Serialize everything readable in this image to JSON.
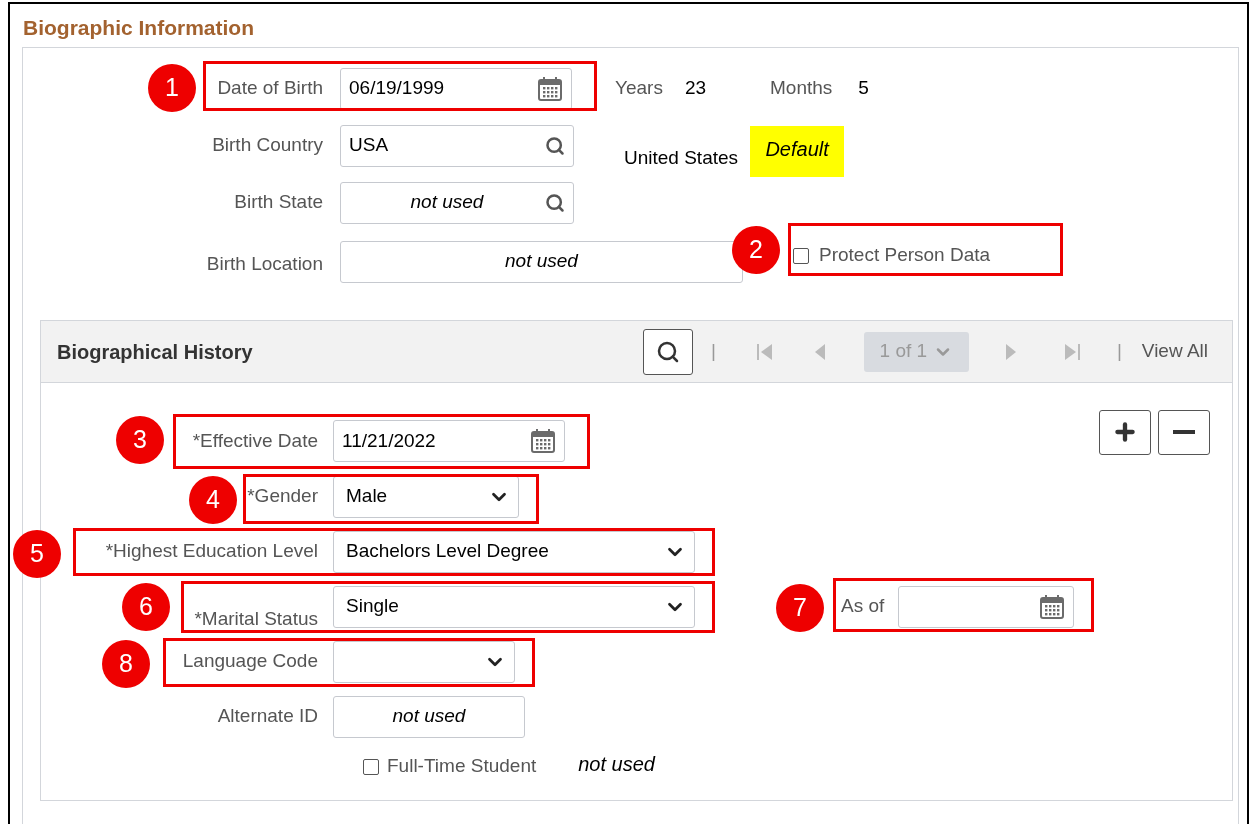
{
  "section": {
    "title": "Biographic Information"
  },
  "fields": [
    {
      "kind": "date",
      "label": "Date of Birth",
      "value": "06/19/1999"
    },
    {
      "kind": "lookup",
      "label": "Birth Country",
      "value": "USA"
    },
    {
      "kind": "lookup",
      "label": "Birth State",
      "note": "not used"
    },
    {
      "kind": "text",
      "label": "Birth Location",
      "note": "not used"
    }
  ],
  "age": {
    "years_label": "Years",
    "years": "23",
    "months_label": "Months",
    "months": "5"
  },
  "country_description": "United States",
  "default_tag": "Default",
  "protect_person_data": {
    "label": "Protect Person Data",
    "checked": false
  },
  "history": {
    "title": "Biographical History",
    "pager": "1 of 1",
    "view_all": "View All",
    "separators": [
      "|",
      "|"
    ],
    "fields": [
      {
        "kind": "date",
        "label": "*Effective Date",
        "value": "11/21/2022"
      },
      {
        "kind": "select",
        "label": "*Gender",
        "value": "Male"
      },
      {
        "kind": "select",
        "label": "*Highest Education Level",
        "value": "Bachelors Level Degree"
      },
      {
        "kind": "select",
        "label": "*Marital Status",
        "value": "Single"
      },
      {
        "kind": "select",
        "label": "Language Code"
      },
      {
        "kind": "text",
        "label": "Alternate ID",
        "note": "not used"
      }
    ],
    "as_of": {
      "label": "As of"
    },
    "full_time_student": {
      "label": "Full-Time Student",
      "checked": false,
      "note": "not used"
    }
  },
  "callouts": [
    "1",
    "2",
    "3",
    "4",
    "5",
    "6",
    "7",
    "8"
  ]
}
